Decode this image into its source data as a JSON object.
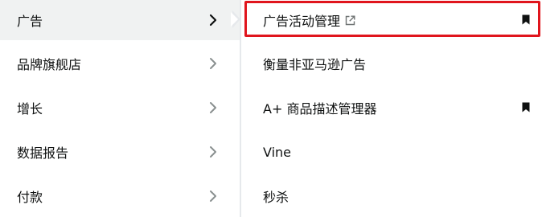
{
  "left_menu": {
    "items": [
      {
        "label": "广告",
        "icon": "chevron-right-icon",
        "active": true
      },
      {
        "label": "品牌旗舰店",
        "icon": "chevron-right-icon"
      },
      {
        "label": "增长",
        "icon": "chevron-right-icon"
      },
      {
        "label": "数据报告",
        "icon": "chevron-right-icon"
      },
      {
        "label": "付款",
        "icon": "chevron-right-icon"
      }
    ]
  },
  "right_menu": {
    "items": [
      {
        "label": "广告活动管理",
        "icon": "external-link-icon",
        "bookmarked": true,
        "highlighted": true
      },
      {
        "label": "衡量非亚马逊广告"
      },
      {
        "label": "A+ 商品描述管理器",
        "bookmarked": true
      },
      {
        "label": "Vine"
      },
      {
        "label": "秒杀"
      }
    ]
  },
  "colors": {
    "active_bg": "#f0f2f2",
    "text": "#0f1111",
    "chevron_dark": "#0f1111",
    "chevron_gray": "#8a9090",
    "highlight_border": "#e0151d",
    "divider": "#e6e9ec"
  }
}
